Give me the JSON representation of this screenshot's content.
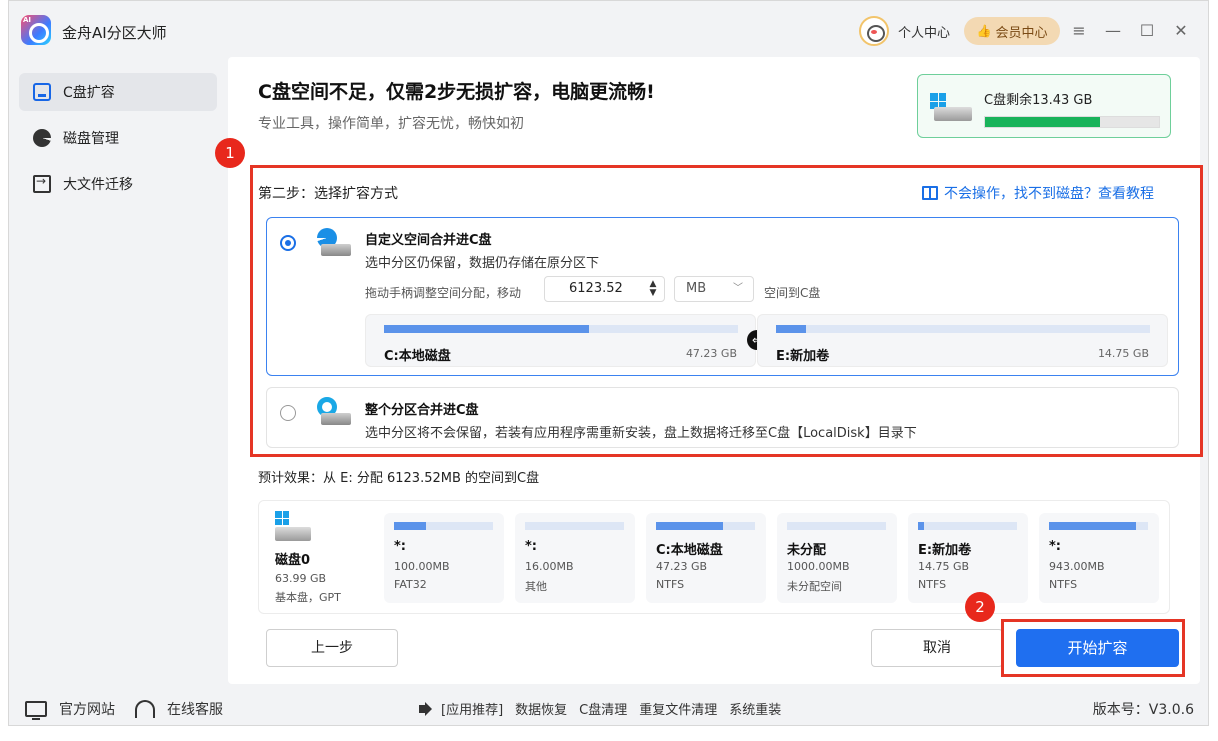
{
  "app": {
    "title": "金舟AI分区大师",
    "logo_badge": "AI"
  },
  "header": {
    "user_label": "个人中心",
    "vip_label": "会员中心",
    "window_controls": [
      "≡",
      "—",
      "☐",
      "✕"
    ]
  },
  "sidebar": {
    "items": [
      {
        "label": "C盘扩容",
        "icon": "disk-icon",
        "active": true
      },
      {
        "label": "磁盘管理",
        "icon": "pie-chart-icon",
        "active": false
      },
      {
        "label": "大文件迁移",
        "icon": "file-move-icon",
        "active": false
      }
    ]
  },
  "main": {
    "headline": "C盘空间不足，仅需2步无损扩容，电脑更流畅!",
    "subline": "专业工具，操作简单，扩容无忧，畅快如初",
    "c_free": {
      "label": "C盘剩余13.43 GB",
      "fill_percent": 66,
      "color": "#19b35a"
    },
    "markers": [
      "1",
      "2"
    ],
    "step_title": "第二步：选择扩容方式",
    "help_link": "不会操作，找不到磁盘？查看教程",
    "options": [
      {
        "title": "自定义空间合并进C盘",
        "desc": "选中分区仍保留，数据仍存储在原分区下",
        "selected": true,
        "adjust_label": "拖动手柄调整空间分配，移动",
        "amount": "6123.52",
        "unit": "MB",
        "to_label": "空间到C盘",
        "source": {
          "name": "C:本地磁盘",
          "size": "47.23 GB",
          "fill_percent": 58
        },
        "target": {
          "name": "E:新加卷",
          "size": "14.75 GB",
          "fill_percent": 8
        }
      },
      {
        "title": "整个分区合并进C盘",
        "desc": "选中分区将不会保留，若装有应用程序需重新安装，盘上数据将迁移至C盘【LocalDisk】目录下",
        "selected": false
      }
    ],
    "estimate": "预计效果：从 E: 分配 6123.52MB 的空间到C盘",
    "disk": {
      "name": "磁盘0",
      "size": "63.99 GB",
      "type": "基本盘，GPT"
    },
    "partitions": [
      {
        "name": "*:",
        "size": "100.00MB",
        "fs": "FAT32",
        "fill_percent": 32
      },
      {
        "name": "*:",
        "size": "16.00MB",
        "fs": "其他",
        "fill_percent": 0
      },
      {
        "name": "C:本地磁盘",
        "size": "47.23 GB",
        "fs": "NTFS",
        "fill_percent": 68
      },
      {
        "name": "未分配",
        "size": "1000.00MB",
        "fs": "未分配空间",
        "fill_percent": 0
      },
      {
        "name": "E:新加卷",
        "size": "14.75 GB",
        "fs": "NTFS",
        "fill_percent": 6
      },
      {
        "name": "*:",
        "size": "943.00MB",
        "fs": "NTFS",
        "fill_percent": 88
      }
    ],
    "buttons": {
      "prev": "上一步",
      "cancel": "取消",
      "start": "开始扩容"
    }
  },
  "footer": {
    "website": "官方网站",
    "support": "在线客服",
    "recommend": "[应用推荐]",
    "links": [
      "数据恢复",
      "C盘清理",
      "重复文件清理",
      "系统重装"
    ],
    "version": "版本号：V3.0.6"
  },
  "colors": {
    "accent": "#1f6ff0",
    "highlight_red": "#e53525",
    "bar_blue": "#5b93ea"
  }
}
